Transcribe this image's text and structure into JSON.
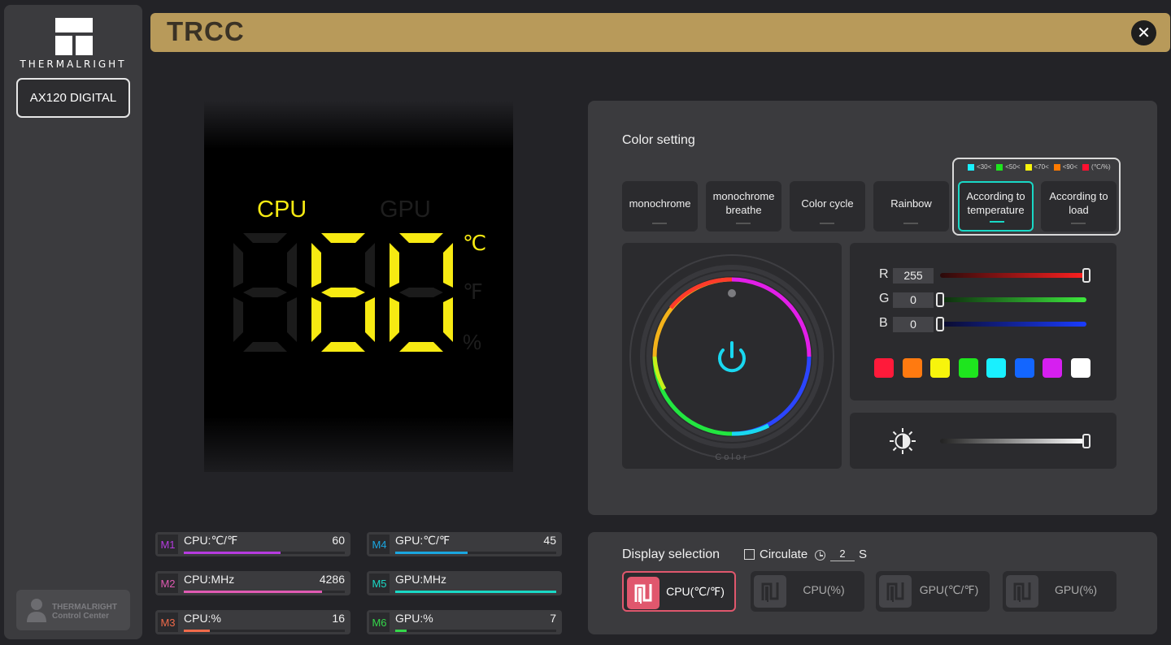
{
  "brand": {
    "name": "THERMALRIGHT",
    "badge_line1": "THERMALRIGHT",
    "badge_line2": "Control Center"
  },
  "sidebar": {
    "device": "AX120 DIGITAL"
  },
  "header": {
    "title": "TRCC",
    "close_icon": "close-icon"
  },
  "preview": {
    "label_cpu": "CPU",
    "label_gpu": "GPU",
    "digits": "60",
    "unit_c": "℃",
    "unit_f": "℉",
    "unit_pct": "%",
    "active_color": "#f7ea12"
  },
  "monitors": [
    {
      "key": "M1",
      "name": "CPU:℃/℉",
      "value": "60",
      "level": 0.6,
      "color": "#b63be0"
    },
    {
      "key": "M4",
      "name": "GPU:℃/℉",
      "value": "45",
      "level": 0.45,
      "color": "#1aa6e0"
    },
    {
      "key": "M2",
      "name": "CPU:MHz",
      "value": "4286",
      "level": 0.86,
      "color": "#e05ab3"
    },
    {
      "key": "M5",
      "name": "GPU:MHz",
      "value": "",
      "level": 1.0,
      "color": "#19d9c6"
    },
    {
      "key": "M3",
      "name": "CPU:%",
      "value": "16",
      "level": 0.16,
      "color": "#f06a4a"
    },
    {
      "key": "M6",
      "name": "GPU:%",
      "value": "7",
      "level": 0.07,
      "color": "#34d74a"
    }
  ],
  "color_setting": {
    "title": "Color setting",
    "modes": [
      {
        "label": "monochrome",
        "active": false
      },
      {
        "label": "monochrome breathe",
        "active": false
      },
      {
        "label": "Color cycle",
        "active": false
      },
      {
        "label": "Rainbow",
        "active": false
      },
      {
        "label": "According to temperature",
        "active": true
      },
      {
        "label": "According to load",
        "active": false
      }
    ],
    "legend": [
      {
        "color": "#19f0ff",
        "label": "<30<"
      },
      {
        "color": "#1ee51e",
        "label": "<50<"
      },
      {
        "color": "#f7f40c",
        "label": "<70<"
      },
      {
        "color": "#ff7a00",
        "label": "<90<"
      },
      {
        "color": "#ff1030",
        "label": "(℃/%)"
      }
    ],
    "wheel_label": "Color",
    "power_icon": "power-icon",
    "rgb": [
      {
        "label": "R",
        "value": "255",
        "level": 1.0
      },
      {
        "label": "G",
        "value": "0",
        "level": 0.0
      },
      {
        "label": "B",
        "value": "0",
        "level": 0.0
      }
    ],
    "presets": [
      "#ff1a3a",
      "#ff7a10",
      "#f7f40c",
      "#1ee51e",
      "#19f0ff",
      "#1366ff",
      "#d61ff0",
      "#ffffff"
    ],
    "brightness_icon": "brightness-icon",
    "brightness": 1.0
  },
  "display_selection": {
    "title": "Display selection",
    "circulate_label": "Circulate",
    "seconds": "2",
    "seconds_unit": "S",
    "options": [
      {
        "label": "CPU(℃/℉)",
        "active": true
      },
      {
        "label": "CPU(%)",
        "active": false
      },
      {
        "label": "GPU(℃/℉)",
        "active": false
      },
      {
        "label": "GPU(%)",
        "active": false
      }
    ]
  }
}
